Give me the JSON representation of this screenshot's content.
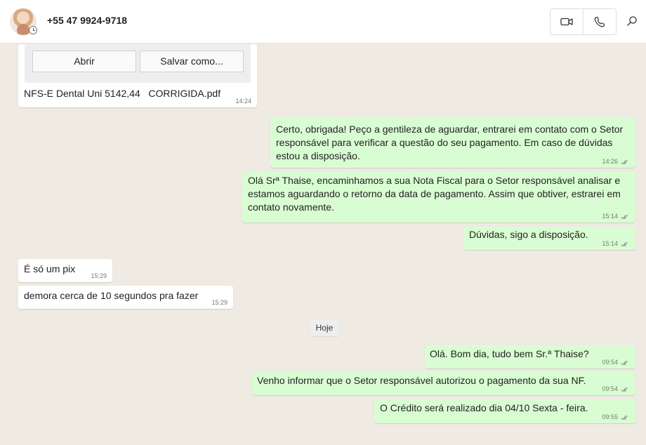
{
  "header": {
    "contact_name": "+55 47 9924-9718"
  },
  "icons": {
    "video": "video-call-icon",
    "phone": "voice-call-icon",
    "search": "search-icon"
  },
  "attachment": {
    "open_label": "Abrir",
    "save_label": "Salvar como...",
    "file_name": "NFS-E Dental Uni 5142,44   CORRIGIDA.pdf",
    "time": "14:24"
  },
  "messages": [
    {
      "text": "Certo, obrigada! Peço a gentileza de aguardar, entrarei em contato com o Setor responsável para verificar a questão do seu pagamento. Em caso de dúvidas estou a disposição.",
      "time": "14:26"
    },
    {
      "text": "Olá Srª Thaise, encaminhamos a sua Nota Fiscal para o Setor responsável analisar e estamos aguardando o retorno da data de pagamento. Assim que obtiver, estrarei em contato novamente.",
      "time": "15:14"
    },
    {
      "text": "Dúvidas, sigo a disposição.",
      "time": "15:14"
    },
    {
      "text": "É só um pix",
      "time": "15:29"
    },
    {
      "text": "demora cerca de 10 segundos pra fazer",
      "time": "15:29"
    },
    {
      "text": "Olá. Bom dia, tudo bem Sr.ª Thaise?",
      "time": "09:54"
    },
    {
      "text": "Venho informar que o Setor responsável autorizou o pagamento da sua NF.",
      "time": "09:54"
    },
    {
      "text": "O Crédito será realizado dia 04/10 Sexta - feira.",
      "time": "09:55"
    }
  ],
  "date_separator": "Hoje",
  "colors": {
    "chat_background": "#efeae2",
    "outgoing_bubble": "#d9fdd3",
    "incoming_bubble": "#ffffff"
  }
}
